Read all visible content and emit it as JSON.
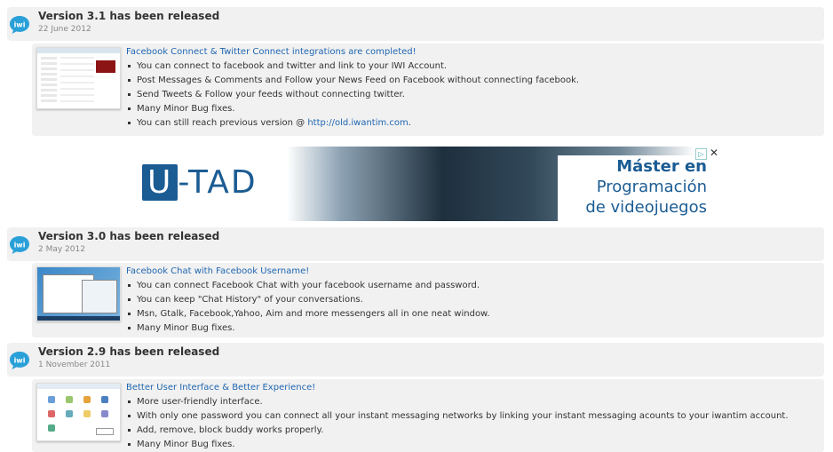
{
  "releases": [
    {
      "title": "Version 3.1 has been released",
      "date": "22 June 2012",
      "headline": "Facebook Connect & Twitter Connect integrations are completed!",
      "bullets": [
        "You can connect to facebook and twitter and link to your IWI Account.",
        "Post Messages & Comments and Follow your News Feed on Facebook without connecting facebook.",
        "Send Tweets & Follow your feeds without connecting twitter.",
        "Many Minor Bug fixes."
      ],
      "old_version_prefix": "You can still reach previous version @ ",
      "old_version_link": "http://old.iwantim.com",
      "old_version_suffix": "."
    },
    {
      "title": "Version 3.0 has been released",
      "date": "2 May 2012",
      "headline": "Facebook Chat with Facebook Username!",
      "bullets": [
        "You can connect Facebook Chat with your facebook username and password.",
        "You can keep \"Chat History\" of your conversations.",
        "Msn, Gtalk, Facebook,Yahoo, Aim and more messengers all in one neat window.",
        "Many Minor Bug fixes."
      ]
    },
    {
      "title": "Version 2.9 has been released",
      "date": "1 November 2011",
      "headline": "Better User Interface & Better Experience!",
      "bullets": [
        "More user-friendly interface.",
        "With only one password you can connect all your instant messaging networks by linking your instant messaging acounts to your iwantim account.",
        "Add, remove, block buddy works properly.",
        "Many Minor Bug fixes."
      ]
    }
  ],
  "ad": {
    "brand_u": "U",
    "brand_rest": "-TAD",
    "line1": "Máster en",
    "line2": "Programación",
    "line3": "de videojuegos",
    "close": "✕",
    "adchoice": "▷"
  },
  "logo_text": "iwi",
  "colors": {
    "link": "#1f66b0",
    "panel": "#f1f1f1",
    "brand": "#1b5c93"
  }
}
